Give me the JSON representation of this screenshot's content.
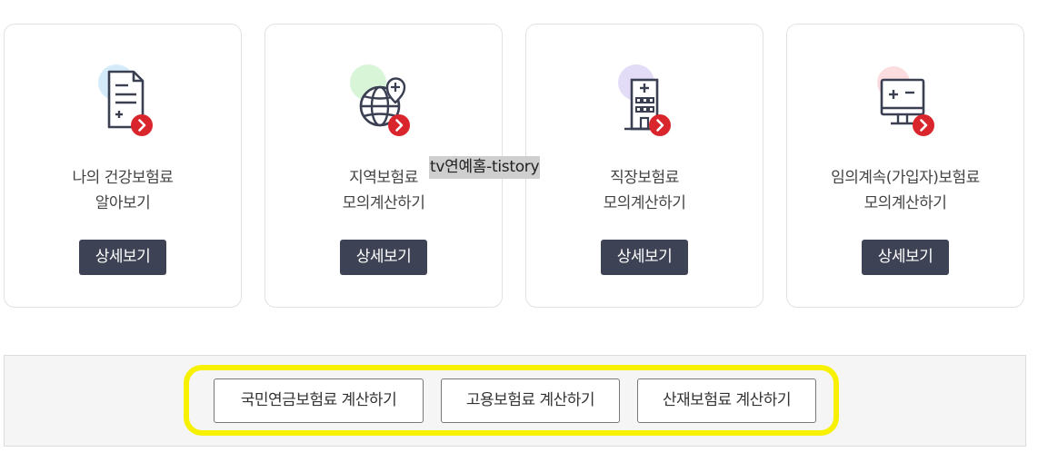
{
  "cards": [
    {
      "title_line1": "나의 건강보험료",
      "title_line2": "알아보기",
      "button": "상세보기",
      "icon": "document-plus-icon",
      "accent": "#d6ebfa"
    },
    {
      "title_line1": "지역보험료",
      "title_line2": "모의계산하기",
      "button": "상세보기",
      "icon": "globe-pin-icon",
      "accent": "#d8f5d8"
    },
    {
      "title_line1": "직장보험료",
      "title_line2": "모의계산하기",
      "button": "상세보기",
      "icon": "hospital-building-icon",
      "accent": "#e3dcf7"
    },
    {
      "title_line1": "임의계속(가입자)보험료",
      "title_line2": "모의계산하기",
      "button": "상세보기",
      "icon": "monitor-calculator-icon",
      "accent": "#fbdde0"
    }
  ],
  "watermark": "tv연예홈-tistory",
  "calc_buttons": [
    "국민연금보험료 계산하기",
    "고용보험료 계산하기",
    "산재보험료 계산하기"
  ],
  "colors": {
    "detail_button": "#3d4254",
    "arrow_badge": "#d9262c",
    "highlight": "#f7f100"
  }
}
